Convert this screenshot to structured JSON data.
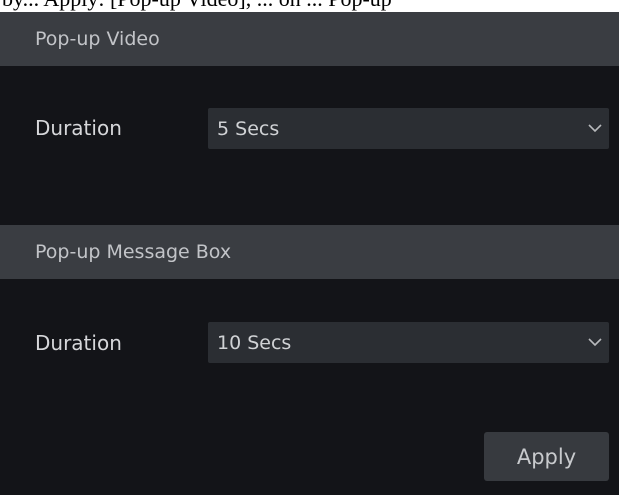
{
  "top_strip_text": "by... Apply: [Pop-up Video], ... on ... Pop-up",
  "popup_video": {
    "header": "Pop-up Video",
    "duration_label": "Duration",
    "duration_value": "5 Secs"
  },
  "popup_message_box": {
    "header": "Pop-up Message Box",
    "duration_label": "Duration",
    "duration_value": "10 Secs"
  },
  "apply_label": "Apply",
  "icons": {
    "dropdown": "chevron-down-icon"
  },
  "colors": {
    "panel_background": "#131418",
    "section_header": "#3a3d42",
    "select_background": "#2b2e33",
    "button_background": "#373a3f"
  }
}
